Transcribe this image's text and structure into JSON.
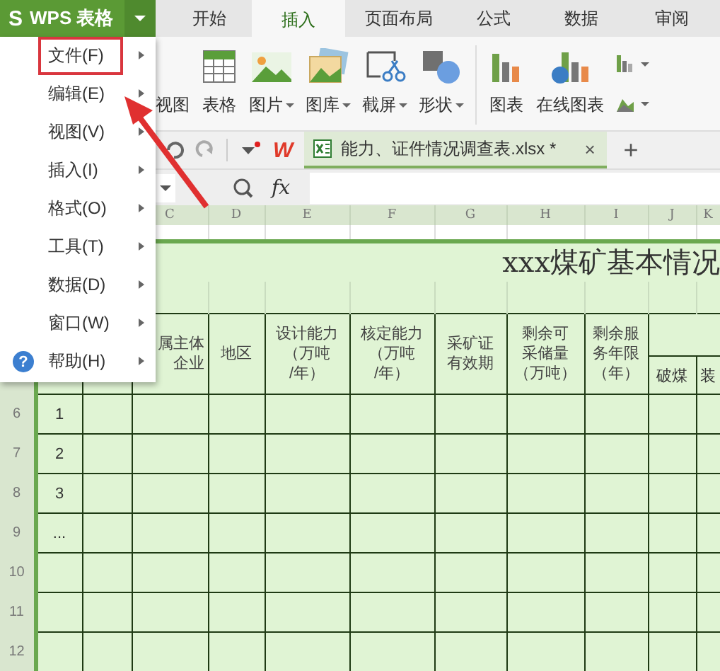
{
  "app_button": {
    "logo": "S",
    "label": "WPS 表格"
  },
  "tabs": [
    {
      "label": "开始",
      "selected": false
    },
    {
      "label": "插入",
      "selected": true
    },
    {
      "label": "页面布局",
      "selected": false
    },
    {
      "label": "公式",
      "selected": false
    },
    {
      "label": "数据",
      "selected": false
    },
    {
      "label": "审阅",
      "selected": false
    }
  ],
  "ribbon": {
    "items": [
      {
        "label": "视图",
        "kind": "partial",
        "dropdown": false
      },
      {
        "label": "表格",
        "kind": "table",
        "dropdown": false
      },
      {
        "label": "图片",
        "kind": "picture",
        "dropdown": true
      },
      {
        "label": "图库",
        "kind": "gallery",
        "dropdown": true
      },
      {
        "label": "截屏",
        "kind": "screenshot",
        "dropdown": true
      },
      {
        "label": "形状",
        "kind": "shape",
        "dropdown": true
      },
      {
        "label": "图表",
        "kind": "chart",
        "dropdown": false
      },
      {
        "label": "在线图表",
        "kind": "online_chart",
        "dropdown": false
      }
    ]
  },
  "toolbar": {
    "logo_glyph": "W",
    "document_tab": {
      "title": "能力、证件情况调查表.xlsx *",
      "close": "×"
    },
    "new_tab": "+"
  },
  "formula_bar": {
    "fx": "fx"
  },
  "sheet": {
    "column_headers": [
      "C",
      "D",
      "E",
      "F",
      "G",
      "H",
      "I",
      "J",
      "K"
    ],
    "title": "xxx煤矿基本情况",
    "header_cells": [
      {
        "lines": [
          "属主体",
          "企业"
        ]
      },
      {
        "lines": [
          "地区"
        ]
      },
      {
        "lines": [
          "设计能力",
          "（万吨",
          "/年）"
        ]
      },
      {
        "lines": [
          "核定能力",
          "（万吨",
          "/年）"
        ]
      },
      {
        "lines": [
          "采矿证",
          "有效期"
        ]
      },
      {
        "lines": [
          "剩余可",
          "采储量",
          "（万吨）"
        ]
      },
      {
        "lines": [
          "剩余服",
          "务年限",
          "（年）"
        ]
      }
    ],
    "sub_headers": [
      "破煤",
      "装"
    ],
    "rows": [
      {
        "row": "6",
        "value": "1"
      },
      {
        "row": "7",
        "value": "2"
      },
      {
        "row": "8",
        "value": "3"
      },
      {
        "row": "9",
        "value": "..."
      },
      {
        "row": "10"
      },
      {
        "row": "11"
      },
      {
        "row": "12"
      }
    ]
  },
  "menu": {
    "items": [
      {
        "label": "文件(F)",
        "kind": "plain",
        "highlighted": true
      },
      {
        "label": "编辑(E)",
        "kind": "plain",
        "highlighted": false
      },
      {
        "label": "视图(V)",
        "kind": "plain",
        "highlighted": false
      },
      {
        "label": "插入(I)",
        "kind": "plain",
        "highlighted": false
      },
      {
        "label": "格式(O)",
        "kind": "plain",
        "highlighted": false
      },
      {
        "label": "工具(T)",
        "kind": "plain",
        "highlighted": false
      },
      {
        "label": "数据(D)",
        "kind": "plain",
        "highlighted": false
      },
      {
        "label": "窗口(W)",
        "kind": "plain",
        "highlighted": false
      },
      {
        "label": "帮助(H)",
        "kind": "help",
        "glyph": "?",
        "highlighted": false
      }
    ]
  }
}
